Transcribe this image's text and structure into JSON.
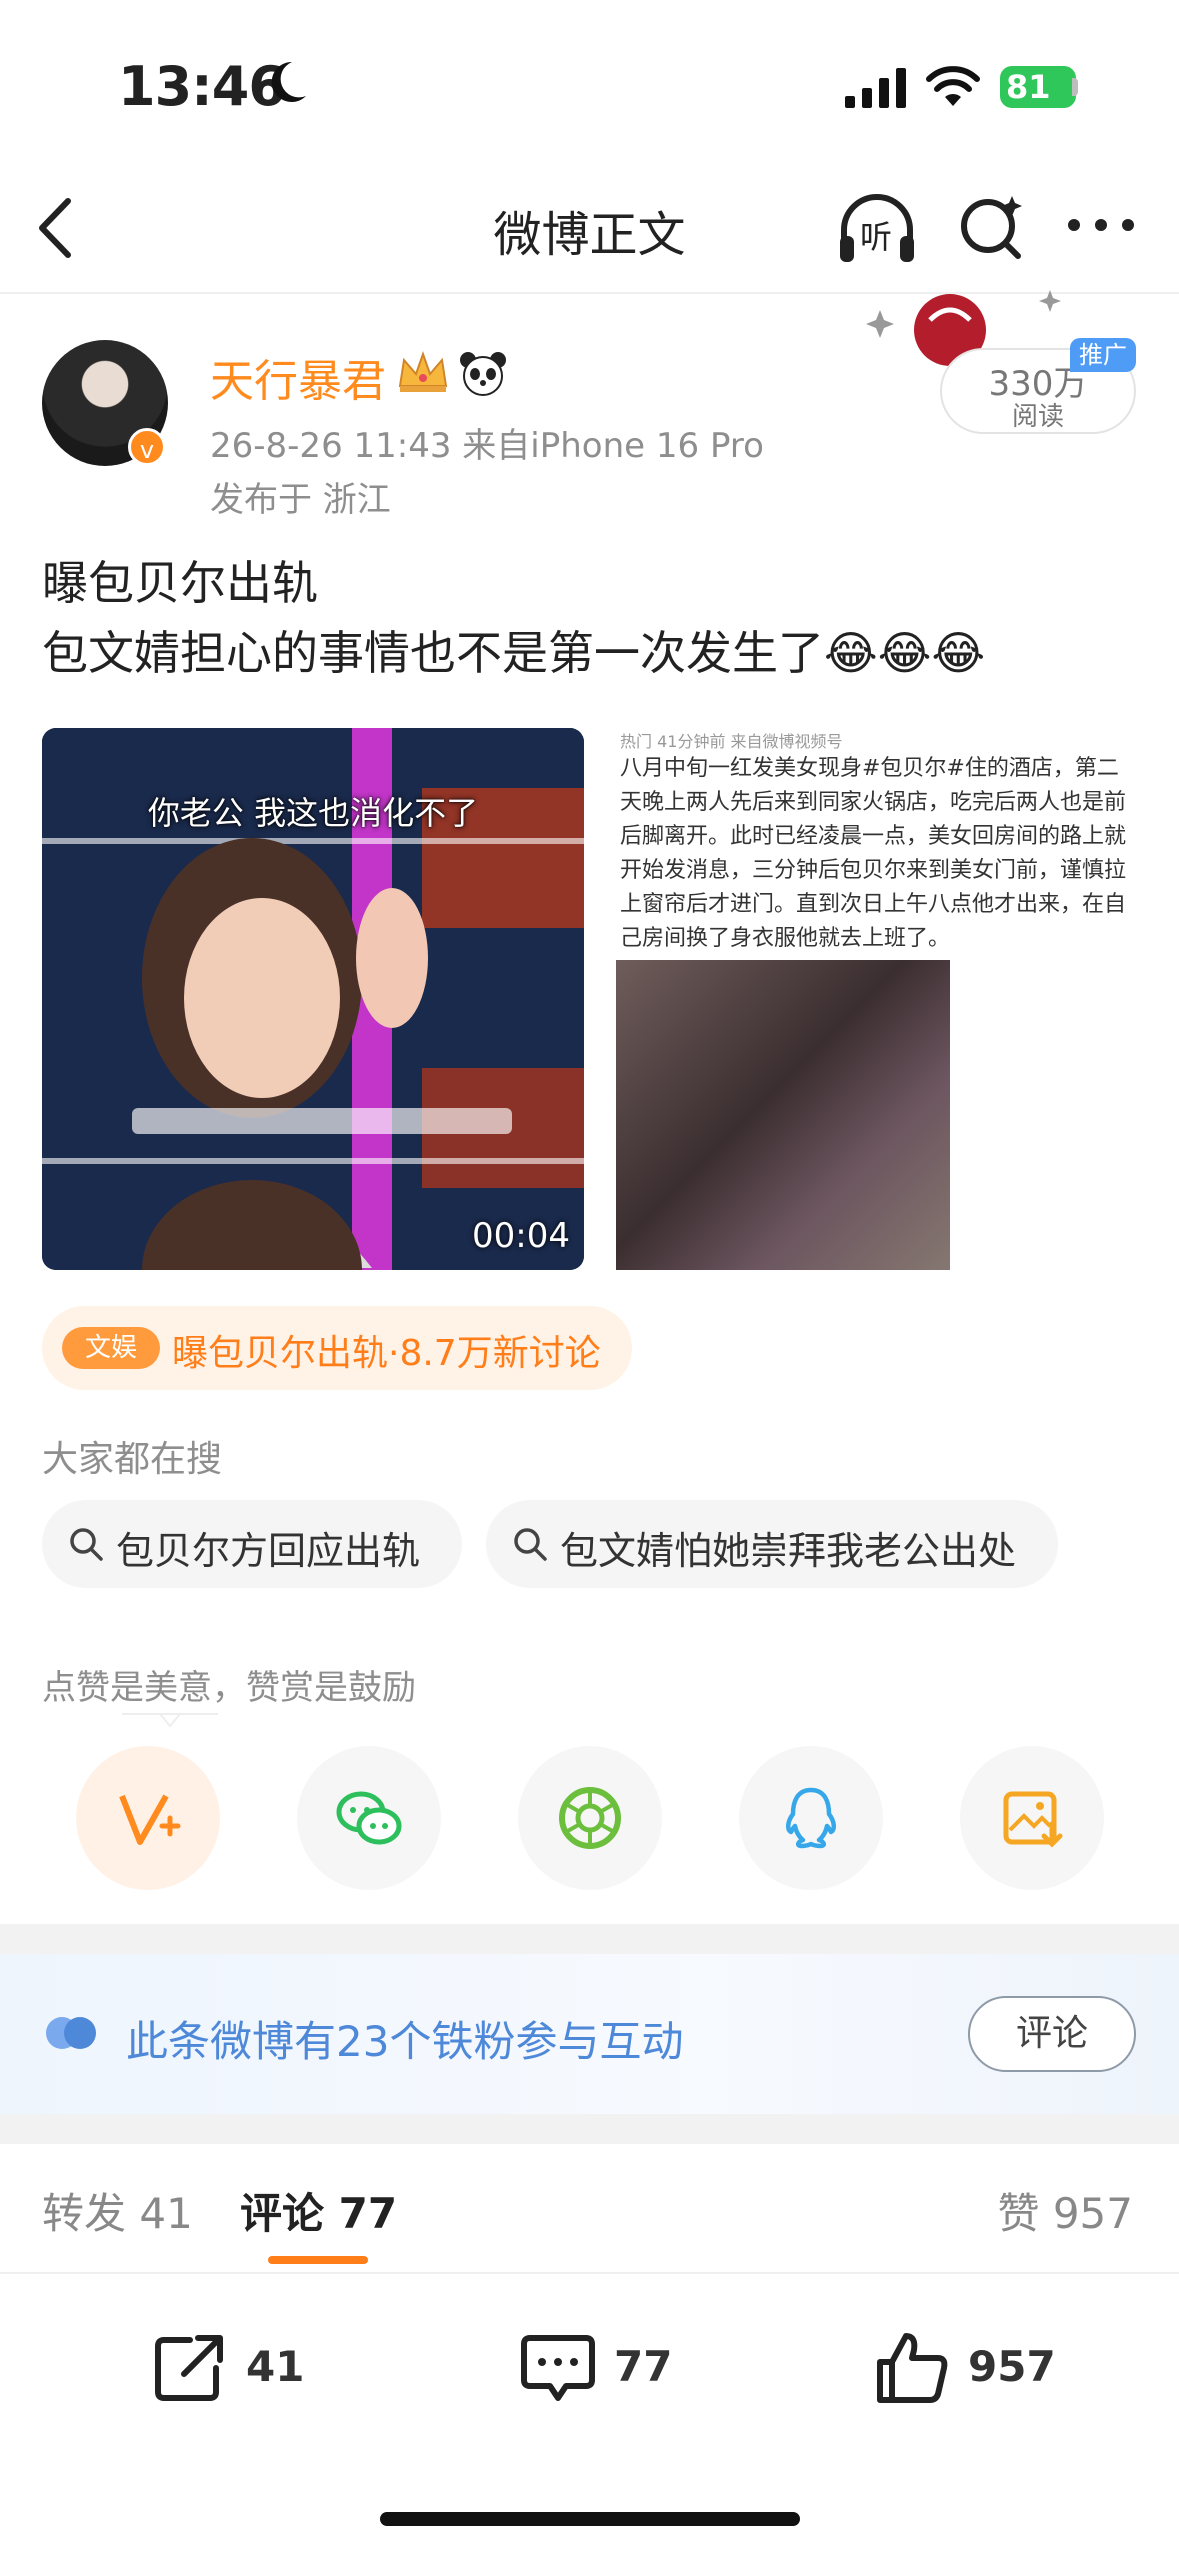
{
  "status_bar": {
    "time": "13:46",
    "battery": "81"
  },
  "nav": {
    "title": "微博正文",
    "listen_label": "听"
  },
  "post": {
    "author": "天行暴君",
    "meta": "26-8-26 11:43  来自iPhone 16 Pro",
    "location": "发布于 浙江",
    "text": "曝包贝尔出轨\n包文婧担心的事情也不是第一次发生了😂😂😂",
    "read_count": "330万",
    "read_label": "阅读",
    "ad_tag": "推广"
  },
  "media": {
    "video": {
      "caption": "你老公 我这也消化不了",
      "duration": "00:04"
    },
    "image2": {
      "header": "热门  41分钟前  来自微博视频号",
      "text": "八月中旬一红发美女现身#包贝尔#住的酒店，第二天晚上两人先后来到同家火锅店，吃完后两人也是前后脚离开。此时已经凌晨一点，美女回房间的路上就开始发消息，三分钟后包贝尔来到美女门前，谨慎拉上窗帘后才进门。直到次日上午八点他才出来，在自己房间换了身衣服他就去上班了。"
    }
  },
  "topic": {
    "tag": "文娱",
    "text": "曝包贝尔出轨·8.7万新讨论"
  },
  "search": {
    "heading": "大家都在搜",
    "chips": [
      "包贝尔方回应出轨",
      "包文婧怕她崇拜我老公出处"
    ]
  },
  "like_hint": "点赞是美意，赞赏是鼓励",
  "share_icons": [
    "reward-v-plus-icon",
    "wechat-icon",
    "moments-icon",
    "qq-icon",
    "save-image-icon"
  ],
  "fan_banner": {
    "text": "此条微博有23个铁粉参与互动",
    "button": "评论"
  },
  "tabs": {
    "repost_label": "转发",
    "repost_count": "41",
    "comment_label": "评论",
    "comment_count": "77",
    "like_label": "赞",
    "like_count": "957"
  },
  "actions": {
    "repost": "41",
    "comment": "77",
    "like": "957"
  },
  "colors": {
    "accent": "#ff7e1a",
    "blue": "#4e88d8",
    "battery": "#30c75a"
  }
}
